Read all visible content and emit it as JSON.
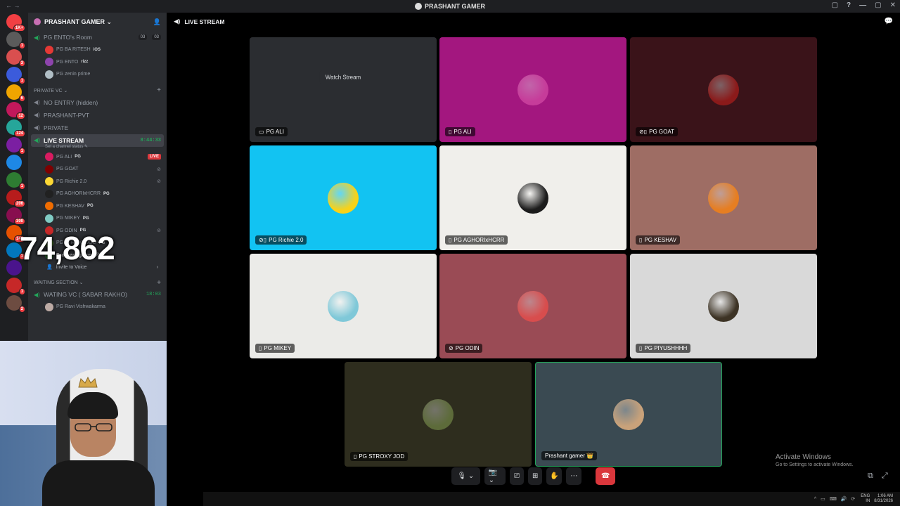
{
  "window": {
    "title": "PRASHANT GAMER",
    "nav": "← →",
    "controls": [
      "▢",
      "?",
      "—",
      "▢",
      "✕"
    ]
  },
  "servers": [
    {
      "color": "#f23f43",
      "badge": "1K+"
    },
    {
      "color": "#5b5b5b",
      "badge": "1"
    },
    {
      "color": "#d94f4f",
      "badge": "3"
    },
    {
      "color": "#3b5bdb",
      "badge": "1"
    },
    {
      "color": "#f0a500",
      "badge": "6"
    },
    {
      "color": "#c2185b",
      "badge": "12"
    },
    {
      "color": "#26a69a",
      "badge": "124"
    },
    {
      "color": "#7b1fa2",
      "badge": "1"
    },
    {
      "color": "#1e88e5",
      "badge": ""
    },
    {
      "color": "#2e7d32",
      "badge": "1"
    },
    {
      "color": "#b71c1c",
      "badge": "206"
    },
    {
      "color": "#880e4f",
      "badge": "300"
    },
    {
      "color": "#e65100",
      "badge": "144"
    },
    {
      "color": "#0277bd",
      "badge": "1"
    },
    {
      "color": "#4a148c",
      "badge": ""
    },
    {
      "color": "#c62828",
      "badge": "1"
    },
    {
      "color": "#6d4c41",
      "badge": "2"
    }
  ],
  "sidebar": {
    "guild_name": "PRASHANT GAMER ⌄",
    "room1": {
      "name": "PG ENTO's Room",
      "count_a": "03",
      "count_b": "03"
    },
    "room1_users": [
      {
        "name": "PG BA RITESH",
        "tag": "iOS",
        "color": "#e53935"
      },
      {
        "name": "PG ENTO",
        "tag": "rizz",
        "color": "#8e44ad"
      },
      {
        "name": "PG zenin prime",
        "tag": "",
        "color": "#b0bec5"
      }
    ],
    "private_cat": "PRIVATE VC ⌄",
    "private_channels": [
      "NO ENTRY (hidden)",
      "PRASHANT-PVT",
      "PRIVATE"
    ],
    "live": {
      "name": "LIVE STREAM",
      "timer": "8:44:33",
      "status": "Set a channel status ✎"
    },
    "live_users": [
      {
        "name": "PG ALI",
        "tag": "PG",
        "color": "#d81b60",
        "extra": "LIVE"
      },
      {
        "name": "PG GOAT",
        "tag": "",
        "color": "#7f0000",
        "extra": "mute"
      },
      {
        "name": "PG Richie 2.0",
        "tag": "",
        "color": "#fdd835",
        "extra": "mute"
      },
      {
        "name": "PG AGHORIxHCRR",
        "tag": "PG",
        "color": "#212121",
        "extra": ""
      },
      {
        "name": "PG KESHAV",
        "tag": "PG",
        "color": "#ef6c00",
        "extra": ""
      },
      {
        "name": "PG MIKEY",
        "tag": "PG",
        "color": "#80cbc4",
        "extra": ""
      },
      {
        "name": "PG ODIN",
        "tag": "PG",
        "color": "#c62828",
        "extra": "mute"
      },
      {
        "name": "PG STROXY JOD",
        "tag": "PG",
        "color": "#558b2f",
        "extra": ""
      },
      {
        "name": "Prashant gamer",
        "tag": "PG",
        "color": "#2e7d32",
        "extra": "",
        "me": true
      }
    ],
    "invite": "Invite to Voice",
    "waiting_cat": "WAITING SECTION ⌄",
    "waiting": {
      "name": "WATING VC ( SABAR RAKHO)",
      "timer": "18:03"
    },
    "waiting_users": [
      {
        "name": "PG Ravi Vishwakarma",
        "color": "#bcaaa4"
      }
    ]
  },
  "overlay_counter": "74,862",
  "main": {
    "header": "LIVE STREAM",
    "watch_stream": "Watch Stream",
    "tiles": [
      {
        "label": "PG ALI",
        "bg": "#2b2d31",
        "avatar": "",
        "watch": true,
        "icon": "screen"
      },
      {
        "label": "PG ALI",
        "bg": "#a3177f",
        "avatar": "#c63c9a",
        "icon": "phone"
      },
      {
        "label": "PG GOAT",
        "bg": "#3a1319",
        "avatar": "#8b1a1a",
        "icon": "mute-phone"
      },
      {
        "label": "PG Richie 2.0",
        "bg": "#12c3f2",
        "avatar": "#f7d21a",
        "icon": "mute-phone"
      },
      {
        "label": "PG AGHORIxHCRR",
        "bg": "#f0efeb",
        "avatar": "#1c1c1c",
        "icon": "phone"
      },
      {
        "label": "PG KESHAV",
        "bg": "#9e6d64",
        "avatar": "#e67e22",
        "icon": "phone"
      },
      {
        "label": "PG MIKEY",
        "bg": "#ebebe8",
        "avatar": "#7fc8d8",
        "icon": "phone"
      },
      {
        "label": "PG ODIN",
        "bg": "#9a4b55",
        "avatar": "#d84d4d",
        "icon": "deafen"
      },
      {
        "label": "PG PIYUSHHHH",
        "bg": "#d9d9d9",
        "avatar": "#3d3325",
        "icon": "phone"
      },
      {
        "label": "PG STROXY JOD",
        "bg": "#2e2d1e",
        "avatar": "#5d6b3a",
        "icon": "phone"
      },
      {
        "label": "Prashant gamer 👑",
        "bg": "#3a4a52",
        "avatar": "#c9a27a",
        "icon": "",
        "speaking": true
      }
    ]
  },
  "controls": [
    "🎙 ⌄",
    "📷 ⌄",
    "⎚",
    "⊞",
    "✋",
    "⋯",
    "☎"
  ],
  "activate": {
    "line1": "Activate Windows",
    "line2": "Go to Settings to activate Windows."
  },
  "corner_icons": [
    "⧉",
    "⤢"
  ],
  "taskbar": {
    "tray": "^ ▭ ⌨ 🔊 ⟳",
    "lang_top": "ENG",
    "lang_bottom": "IN",
    "time": "1:06 AM",
    "date": "8/31/2026"
  }
}
